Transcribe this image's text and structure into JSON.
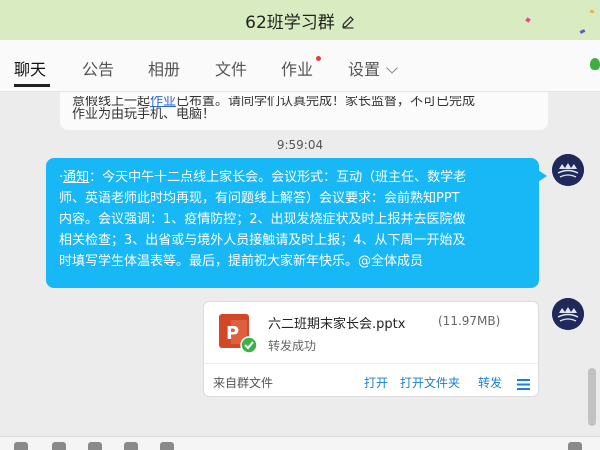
{
  "window": {
    "title": "62班学习群"
  },
  "tabs": [
    {
      "label": "聊天"
    },
    {
      "label": "公告"
    },
    {
      "label": "相册"
    },
    {
      "label": "文件"
    },
    {
      "label": "作业"
    },
    {
      "label": "设置"
    }
  ],
  "active_tab": "聊天",
  "messages": {
    "gray_line1_prefix": "意假线上一起",
    "gray_line1_highlight": "作业",
    "gray_line1_suffix": "已布置。请同学们认真完成！家长监督，不可已完成",
    "gray_line2": "作业为由玩手机、电脑！",
    "timestamp": "9:59:04",
    "notice_prefix": "·",
    "notice_link": "通知",
    "notice_body_1": "：今天中午十二点线上家长会。会议形式：互动（班主任、数学老",
    "notice_body_2": "师、英语老师此时均再现，有问题线上解答）会议要求：会前熟知PPT",
    "notice_body_3": "内容。会议强调：1、疫情防控；2、出现发烧症状及时上报并去医院做",
    "notice_body_4": "相关检查；3、出省或与境外人员接触请及时上报；4、从下周一开始及",
    "notice_body_5": "时填写学生体温表等。最后，提前祝大家新年快乐。@全体成员"
  },
  "file": {
    "name": "六二班期末家长会.pptx",
    "size": "(11.97MB)",
    "status": "转发成功",
    "source": "来自群文件",
    "actions": {
      "open": "打开",
      "open_folder": "打开文件夹",
      "forward": "转发"
    },
    "icon": "pptx-file-icon"
  },
  "colors": {
    "titlebar": "#d9ecc1",
    "bubble_blue": "#18b7f6",
    "link_blue": "#1a7fd0",
    "ppt_orange": "#d24726",
    "success_green": "#3cb34a"
  }
}
